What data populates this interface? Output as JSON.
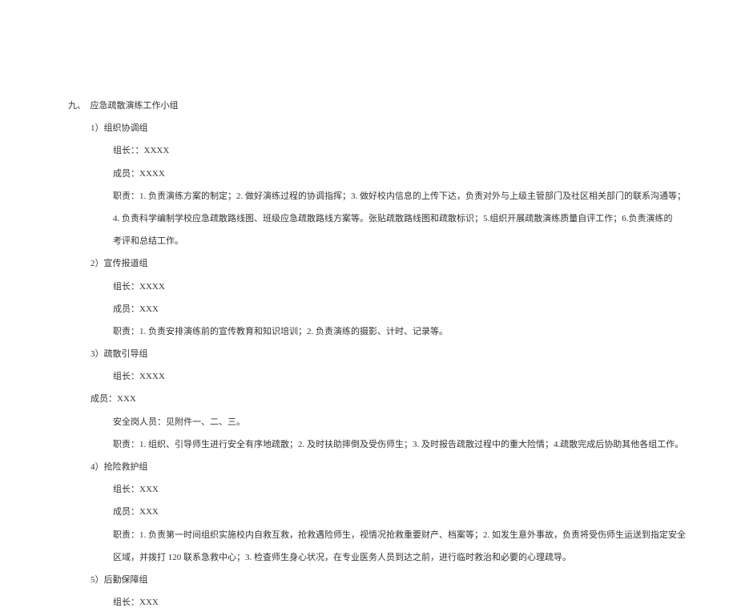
{
  "title": "九、　应急疏散演练工作小组",
  "groups": [
    {
      "name": "1）组织协调组",
      "leader": "组长：：XXXX",
      "members": "成员：XXXX",
      "duty1": "职责：1. 负责演练方案的制定；2. 做好演练过程的协调指挥；3. 做好校内信息的上传下达，负责对外与上级主管部门及社区相关部门的联系沟通等；",
      "duty2": "4. 负责科学编制学校应急疏散路线图、班级应急疏散路线方案等。张贴疏散路线图和疏散标识；5.组织开展疏散演练质量自评工作；6.负责演练的",
      "duty3": "考评和总结工作。"
    },
    {
      "name": "2）宣传报道组",
      "leader": "组长：XXXX",
      "members": "成员：XXX",
      "duty1": "职责：1. 负责安排演练前的宣传教育和知识培训；2. 负责演练的摄影、计时、记录等。"
    },
    {
      "name": "3）疏散引导组",
      "leader": "组长：XXXX",
      "members_mid": "成员：XXX",
      "safety": "安全岗人员：见附件一、二、三。",
      "duty1": "职责：1. 组织、引导师生进行安全有序地疏散；2. 及时扶助摔倒及受伤师生；3. 及时报告疏散过程中的重大险情；4.疏散完成后协助其他各组工作。"
    },
    {
      "name": "4）抢险救护组",
      "leader": "组长：XXX",
      "members": "成员：XXX",
      "duty1": "职责：1. 负责第一时间组织实施校内自救互救，抢救遇险师生，视情况抢救重要财产、档案等；2. 如发生意外事故，负责将受伤师生运送到指定安全",
      "duty2": "区域，并拨打 120 联系急救中心；3. 检查师生身心状况，在专业医务人员到达之前，进行临时救治和必要的心理疏导。"
    },
    {
      "name": "5）后勤保障组",
      "leader": "组长：XXX"
    }
  ]
}
